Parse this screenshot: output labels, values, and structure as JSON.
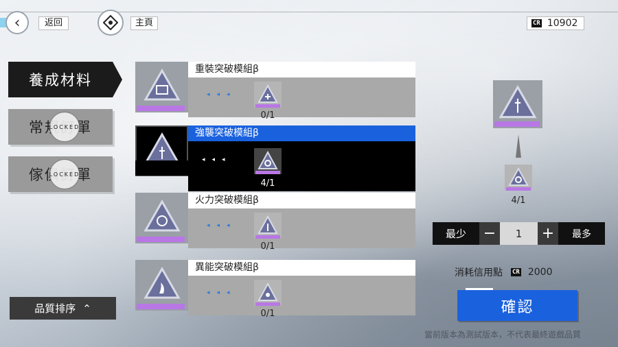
{
  "top_bar": {
    "back_label": "返回",
    "home_label": "主頁",
    "credits": "10902",
    "credit_icon_text": "CR"
  },
  "nav": {
    "items": [
      {
        "label": "養成材料",
        "active": true
      },
      {
        "label": "常規訂單",
        "active": false,
        "locked_text": "LOCKED"
      },
      {
        "label": "傢俱訂單",
        "active": false,
        "locked_text": "LOCKED"
      }
    ]
  },
  "sort": {
    "label": "品質排序",
    "icon": "chevron-up-icon"
  },
  "list": [
    {
      "name": "重裝突破模組β",
      "count": "0/1",
      "icon": "shield-module-icon"
    },
    {
      "name": "強襲突破模組β",
      "count": "4/1",
      "icon": "sword-module-icon",
      "selected": true
    },
    {
      "name": "火力突破模組β",
      "count": "0/1",
      "icon": "target-module-icon"
    },
    {
      "name": "異能突破模組β",
      "count": "0/1",
      "icon": "flame-module-icon"
    }
  ],
  "detail": {
    "target_icon": "sword-module-icon",
    "required_icon": "target-module-icon",
    "required_count": "4/1",
    "qty_min_label": "最少",
    "qty_value": "1",
    "qty_max_label": "最多",
    "cost_label": "消耗信用點",
    "cost_value": "2000",
    "confirm_label": "確認"
  },
  "footer_note": "當前版本為測試版本，不代表最終遊戲品質",
  "colors": {
    "accent_blue": "#1a61de",
    "rarity_purple": "#b877e5",
    "dark": "#111111"
  }
}
